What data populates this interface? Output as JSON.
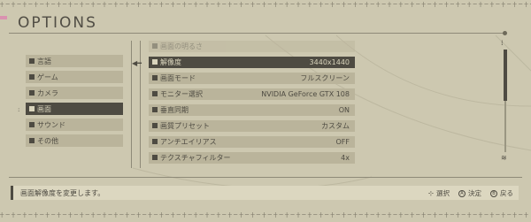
{
  "header": {
    "title": "OPTIONS"
  },
  "left_menu": {
    "items": [
      {
        "label": "言語",
        "active": false
      },
      {
        "label": "ゲーム",
        "active": false
      },
      {
        "label": "カメラ",
        "active": false
      },
      {
        "label": "画面",
        "active": true
      },
      {
        "label": "サウンド",
        "active": false
      },
      {
        "label": "その他",
        "active": false
      }
    ]
  },
  "settings": {
    "items": [
      {
        "label": "画面の明るさ",
        "value": "",
        "dim": true
      },
      {
        "label": "解像度",
        "value": "3440x1440",
        "active": true
      },
      {
        "label": "画面モード",
        "value": "フルスクリーン"
      },
      {
        "label": "モニター選択",
        "value": "NVIDIA GeForce GTX 108"
      },
      {
        "label": "垂直同期",
        "value": "ON"
      },
      {
        "label": "画質プリセット",
        "value": "カスタム"
      },
      {
        "label": "アンチエイリアス",
        "value": "OFF"
      },
      {
        "label": "テクスチャフィルター",
        "value": "4x"
      }
    ]
  },
  "footer": {
    "description": "画面解像度を変更します。",
    "hints": [
      {
        "icon": "dpad-icon",
        "label": "選択"
      },
      {
        "icon": "a-button-icon",
        "glyph": "A",
        "label": "決定"
      },
      {
        "icon": "b-button-icon",
        "glyph": "B",
        "label": "戻る"
      }
    ]
  },
  "colors": {
    "background": "#cdc8b0",
    "item": "#bab49b",
    "active": "#4e4b42",
    "text": "#4e4b42"
  }
}
